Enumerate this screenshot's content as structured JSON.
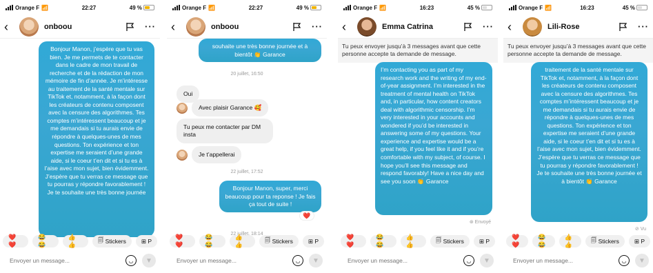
{
  "screens": [
    {
      "status": {
        "carrier": "Orange F",
        "time": "22:27",
        "battery": "49 %",
        "battery_level": 0.49
      },
      "contact": "onboou",
      "messages_out": [
        "Bonjour Manon, j’espère que tu vas bien. Je me permets de te contacter dans le cadre de mon travail de recherche et de la rédaction de mon mémoire de fin d’année. Je m’intéresse au traitement de la santé mentale sur TikTok et, notamment, à la façon dont les créateurs de contenu composent avec la censure des algorithmes. Tes comptes m’intéressent beaucoup et je me demandais si tu aurais envie de répondre à quelques-unes de mes questions. Ton expérience et ton expertise me seraient d’une grande aide, si le coeur t’en dit et si tu es à l’aise avec mon sujet, bien évidemment. J’espère que tu verras ce message que tu pourras y répondre favorablement ! Je te souhaite une très bonne journée"
      ]
    },
    {
      "status": {
        "carrier": "Orange F",
        "time": "22:27",
        "battery": "49 %",
        "battery_level": 0.49
      },
      "contact": "onboou",
      "top_bubble": "souhaite une très bonne journée et à bientôt 👏 Garance",
      "time1": "20 juillet, 16:50",
      "in_oui": "Oui",
      "in_plaisir": "Avec plaisir Garance 🥰",
      "in_contact": "Tu peux me contacter par DM insta",
      "in_appel": "Je t’appellerai",
      "time2": "22 juillet, 17:52",
      "out_reply": "Bonjour Manon, super, merci beaucoup pour ta reponse ! Je fais ça tout de suite !",
      "heart": "❤️",
      "time3": "22 juillet, 18:14"
    },
    {
      "status": {
        "carrier": "Orange F",
        "time": "16:23",
        "battery": "45 %",
        "battery_level": 0.45
      },
      "contact": "Emma Catrina",
      "notice": "Tu peux envoyer jusqu’à 3 messages avant que cette personne accepte ta demande de message.",
      "message": "I’m contacting you as part of my research work and the writing of my end-of-year assignment. I’m interested in the treatment of mental health on TikTok and, in particular, how content creators deal with algorithmic censorship. I’m very interested in your accounts and wondered if you’d be interested in answering some of my questions. Your experience and expertise would be a great help, if you feel like it and if you’re comfortable with my subject, of course. I hope you’ll see this message and respond favorably! Have a nice day and see you soon 👏 Garance",
      "seen": "Envoyé"
    },
    {
      "status": {
        "carrier": "Orange F",
        "time": "16:23",
        "battery": "45 %",
        "battery_level": 0.45
      },
      "contact": "Lili-Rose",
      "notice": "Tu peux envoyer jusqu’à 3 messages avant que cette personne accepte ta demande de message.",
      "message": "traitement de la santé mentale sur TikTok et, notamment, à la façon dont les créateurs de contenu composent avec la censure des algorithmes. Tes comptes m’intéressent beaucoup et je me demandais si tu aurais envie de répondre à quelques-unes de mes questions. Ton expérience et ton expertise me seraient d’une grande aide, si le coeur t’en dit et si tu es à l’aise avec mon sujet, bien évidemment. J’espère que tu verras ce message que tu pourras y répondre favorablement ! Je te souhaite une très bonne journée et à bientôt 👏 Garance",
      "seen": "Vu"
    }
  ],
  "reactions": {
    "r1": "❤️❤️",
    "r2": "😂😂",
    "r3": "👍👍",
    "stickers": "Stickers",
    "more": "P"
  },
  "composer": {
    "placeholder": "Envoyer un message..."
  }
}
